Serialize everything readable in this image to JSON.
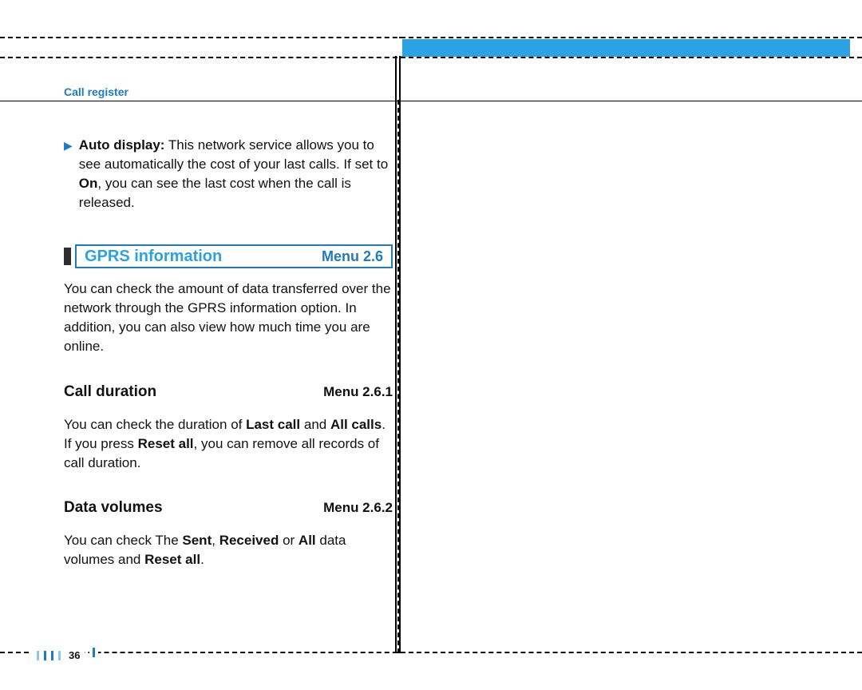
{
  "header": {
    "label": "Call register"
  },
  "bullet": {
    "lead": "Auto display:",
    "text_after_lead": " This network service allows you to see automatically the cost of your last calls. If set to ",
    "bold_on": "On",
    "text_tail": ", you can see the last cost when the call is released."
  },
  "section": {
    "title": "GPRS information",
    "menu": "Menu 2.6"
  },
  "para_gprs": "You can check the amount of data transferred over the network through the GPRS information option. In addition, you can also view how much time you are online.",
  "sub1": {
    "title": "Call duration",
    "menu": "Menu 2.6.1"
  },
  "para_sub1_parts": {
    "p1": "You can check the duration of ",
    "b1": "Last call",
    "p2": " and ",
    "b2": "All calls",
    "p3": ". If you press ",
    "b3": "Reset all",
    "p4": ", you can remove all records of call duration."
  },
  "sub2": {
    "title": "Data volumes",
    "menu": "Menu 2.6.2"
  },
  "para_sub2_parts": {
    "p1": "You can check The ",
    "b1": "Sent",
    "p2": ", ",
    "b2": "Received",
    "p3": " or ",
    "b3": "All",
    "p4": " data volumes and ",
    "b4": "Reset all",
    "p5": "."
  },
  "page_number": "36"
}
